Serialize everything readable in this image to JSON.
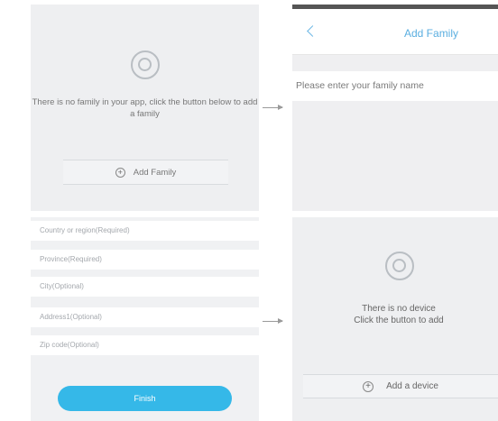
{
  "panel_empty_family": {
    "message": "There is no family in your app, click the button below to add a family",
    "add_label": "Add Family",
    "logo_icon": "ring-logo-icon",
    "add_icon": "plus-circle-icon"
  },
  "panel_add_family": {
    "title": "Add Family",
    "back_icon": "chevron-left-icon",
    "name_placeholder": "Please enter your family name",
    "accent_color": "#5aaee0"
  },
  "panel_address_form": {
    "fields": [
      "Country or region(Required)",
      "Province(Required)",
      "City(Optional)",
      "Address1(Optional)",
      "Zip code(Optional)"
    ],
    "finish_label": "Finish",
    "button_color": "#35b8e8"
  },
  "panel_empty_device": {
    "message_line1": "There is no device",
    "message_line2": "Click the button to add",
    "add_label": "Add a device",
    "logo_icon": "ring-logo-icon",
    "add_icon": "plus-circle-icon"
  }
}
